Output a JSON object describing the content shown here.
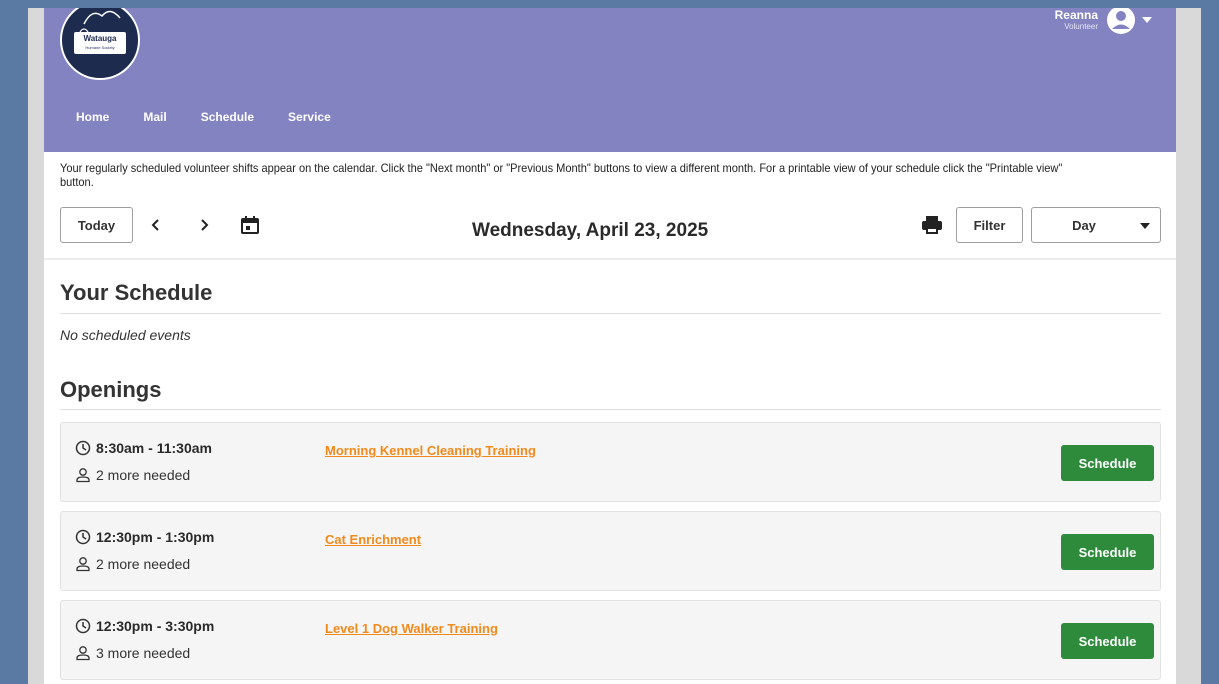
{
  "header": {
    "logo": {
      "name": "Watauga",
      "sub": "Humane Society"
    },
    "user": {
      "name": "Reanna",
      "role": "Volunteer"
    },
    "nav": [
      "Home",
      "Mail",
      "Schedule",
      "Service"
    ]
  },
  "intro": "Your regularly scheduled volunteer shifts appear on the calendar. Click the \"Next month\" or \"Previous Month\" buttons to view a different month. For a printable view of your schedule click the \"Printable view\" button.",
  "toolbar": {
    "today": "Today",
    "date": "Wednesday, April 23, 2025",
    "filter": "Filter",
    "view": "Day"
  },
  "your_schedule": {
    "title": "Your Schedule",
    "empty": "No scheduled events"
  },
  "openings": {
    "title": "Openings",
    "items": [
      {
        "time": "8:30am - 11:30am",
        "needed": "2 more needed",
        "event": "Morning Kennel Cleaning Training",
        "action": "Schedule"
      },
      {
        "time": "12:30pm - 1:30pm",
        "needed": "2 more needed",
        "event": "Cat Enrichment",
        "action": "Schedule"
      },
      {
        "time": "12:30pm - 3:30pm",
        "needed": "3 more needed",
        "event": "Level 1 Dog Walker Training",
        "action": "Schedule"
      }
    ]
  },
  "colors": {
    "page_bg": "#5a79a3",
    "header_bg": "#8383c2",
    "link": "#f08a1c",
    "schedule_button": "#2e8b3c"
  }
}
